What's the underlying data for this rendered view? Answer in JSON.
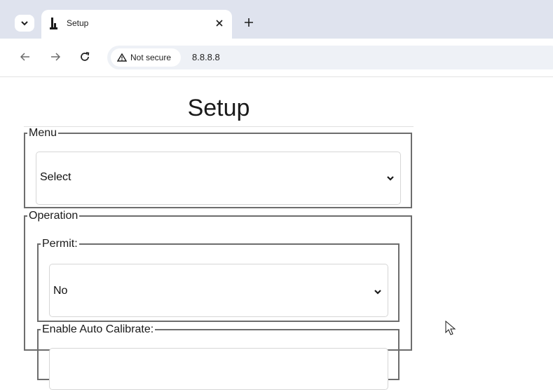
{
  "browser": {
    "tab": {
      "title": "Setup"
    },
    "new_tab_symbol": "+",
    "address": {
      "security_label": "Not secure",
      "url": "8.8.8.8"
    }
  },
  "page": {
    "title": "Setup",
    "menu": {
      "legend": "Menu",
      "select_value": "Select"
    },
    "operation": {
      "legend": "Operation",
      "permit": {
        "legend": "Permit:",
        "select_value": "No"
      },
      "auto_calibrate": {
        "legend": "Enable Auto Calibrate:"
      }
    }
  },
  "icons": [
    "tab-list-chevron-icon",
    "favicon-icon",
    "close-icon",
    "plus-icon",
    "back-arrow-icon",
    "forward-arrow-icon",
    "reload-icon",
    "warning-triangle-icon",
    "chevron-down-icon",
    "mouse-cursor-icon"
  ],
  "colors": {
    "tabbar": "#dfe3ee",
    "omnibox": "#eef1f6",
    "fieldset_border": "#6d6d6d"
  }
}
